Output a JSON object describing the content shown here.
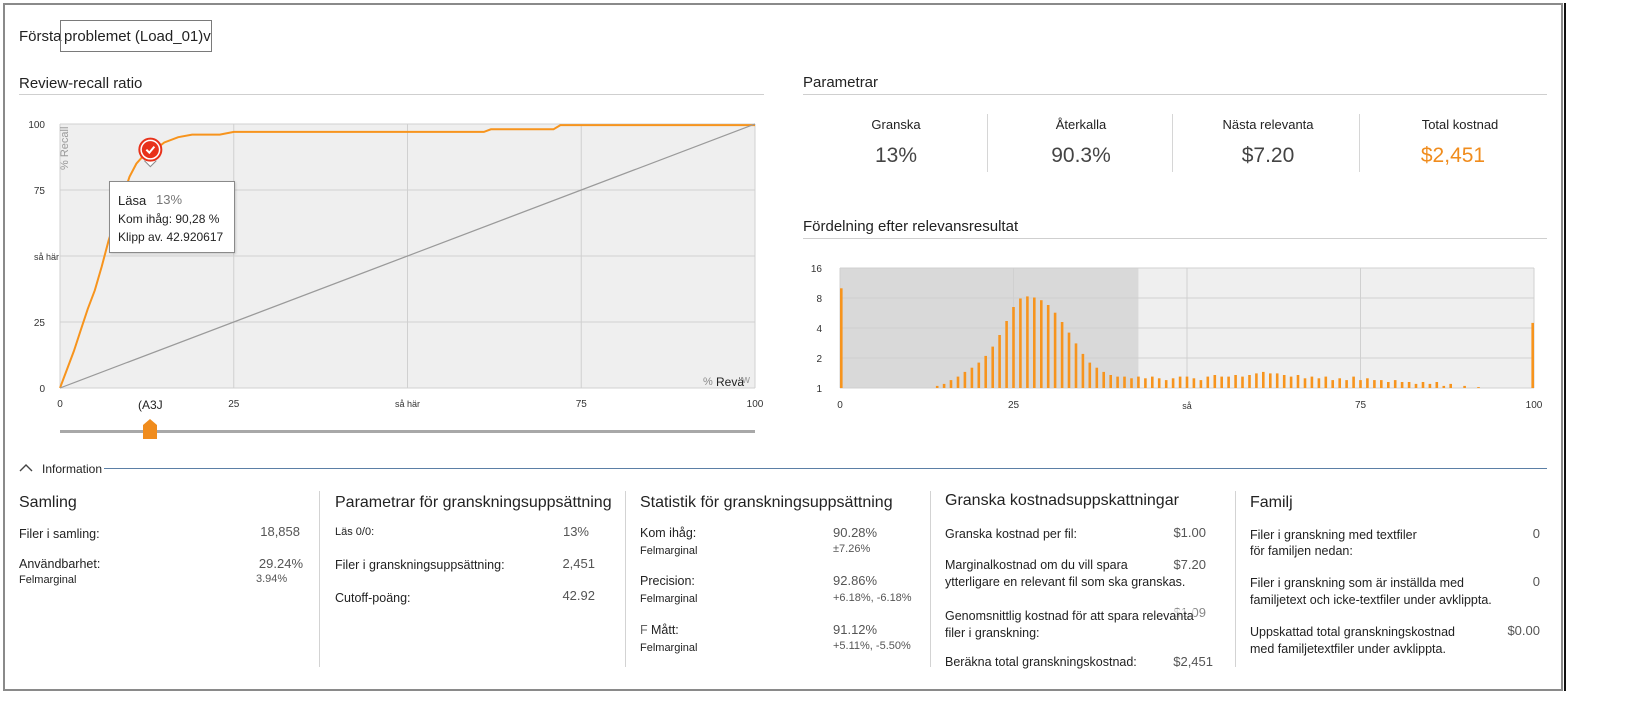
{
  "header": {
    "dropdown_prefix": "Första",
    "dropdown_value": "problemet (Load_01)v"
  },
  "review_chart": {
    "title": "Review-recall ratio",
    "y_axis_label": "% Recall",
    "x_axis_label_prefix": "%",
    "x_axis_label": "Revä",
    "x_axis_label_overlap": "w",
    "y_ticks": [
      "100",
      "75",
      "så här",
      "25",
      "0"
    ],
    "x_ticks": [
      "0",
      "25",
      "så här",
      "75",
      "100"
    ],
    "marker_label": "(A3J",
    "tooltip": {
      "title": "Läsa",
      "review": "13%",
      "recall": "Kom ihåg: 90,28 %",
      "cutoff": "Klipp av. 42.920617"
    },
    "colors": {
      "curve": "#f7941d",
      "diagonal": "#9a9a9a",
      "marker": "#e8321b",
      "plot_bg": "#efefef"
    }
  },
  "chart_data": [
    {
      "type": "line",
      "title": "Review-recall ratio",
      "xlabel": "% Revä",
      "ylabel": "% Recall",
      "xlim": [
        0,
        100
      ],
      "ylim": [
        0,
        100
      ],
      "grid": true,
      "series": [
        {
          "x": [
            0,
            2,
            3,
            4,
            5,
            6,
            7,
            8,
            9,
            10,
            11,
            12,
            13,
            14,
            15,
            17,
            19,
            21,
            23,
            25,
            30,
            40,
            50,
            60,
            61,
            62,
            65,
            70,
            71,
            72,
            80,
            90,
            100
          ],
          "values": [
            0,
            14,
            22,
            30,
            37,
            46,
            56,
            64,
            72,
            80,
            85,
            88,
            90.28,
            91,
            93,
            95,
            96,
            96,
            96,
            97,
            97,
            97,
            97,
            97,
            97,
            98,
            98,
            98,
            98,
            99.6,
            99.6,
            99.6,
            99.6
          ]
        },
        {
          "x": [
            0,
            100
          ],
          "values": [
            0,
            100
          ]
        }
      ]
    },
    {
      "type": "bar",
      "title": "Fördelning efter relevansresultat",
      "xlabel": "så",
      "xlim": [
        0,
        100
      ],
      "y_ticks": [
        "16",
        "8",
        "4",
        "2",
        "1"
      ],
      "x_ticks": [
        "0",
        "25",
        "så",
        "75",
        "100"
      ],
      "highlight_range": [
        0,
        43
      ],
      "x": [
        0,
        14,
        15,
        16,
        17,
        18,
        19,
        20,
        21,
        22,
        23,
        24,
        25,
        26,
        27,
        28,
        29,
        30,
        31,
        32,
        33,
        34,
        35,
        36,
        37,
        38,
        39,
        40,
        41,
        42,
        43,
        44,
        45,
        46,
        47,
        48,
        49,
        50,
        51,
        52,
        53,
        54,
        55,
        56,
        57,
        58,
        59,
        60,
        61,
        62,
        63,
        64,
        65,
        66,
        67,
        68,
        69,
        70,
        71,
        72,
        73,
        74,
        75,
        76,
        77,
        78,
        79,
        80,
        81,
        82,
        83,
        84,
        85,
        86,
        87,
        88,
        90,
        92,
        100
      ],
      "values": [
        10,
        1.05,
        1.1,
        1.2,
        1.3,
        1.45,
        1.6,
        1.8,
        2.1,
        2.6,
        3.4,
        4.7,
        6.5,
        7.9,
        8.3,
        8.1,
        7.6,
        6.8,
        5.7,
        4.6,
        3.6,
        2.8,
        2.2,
        1.8,
        1.6,
        1.45,
        1.35,
        1.3,
        1.3,
        1.25,
        1.3,
        1.25,
        1.3,
        1.25,
        1.2,
        1.25,
        1.3,
        1.3,
        1.25,
        1.2,
        1.3,
        1.35,
        1.3,
        1.3,
        1.35,
        1.3,
        1.35,
        1.4,
        1.45,
        1.4,
        1.4,
        1.35,
        1.3,
        1.35,
        1.25,
        1.3,
        1.25,
        1.3,
        1.2,
        1.25,
        1.2,
        1.3,
        1.2,
        1.25,
        1.2,
        1.2,
        1.15,
        1.2,
        1.15,
        1.15,
        1.1,
        1.15,
        1.1,
        1.15,
        1.05,
        1.1,
        1.05,
        1.02,
        4.5
      ]
    }
  ],
  "slider": {
    "value_percent": 13
  },
  "parameters": {
    "title": "Parametrar",
    "items": [
      {
        "label": "Granska",
        "value": "13%"
      },
      {
        "label": "Återkalla",
        "value": "90.3%"
      },
      {
        "label": "Nästa relevanta",
        "value": "$7.20"
      },
      {
        "label": "Total kostnad",
        "value": "$2,451"
      }
    ],
    "accent": "#f08c1d"
  },
  "distribution": {
    "title": "Fördelning efter relevansresultat",
    "y_ticks": [
      "16",
      "8",
      "4",
      "2",
      "1"
    ],
    "x_ticks": [
      "0",
      "25",
      "så",
      "75",
      "100"
    ],
    "colors": {
      "bar": "#f7941d",
      "highlight": "#d9d9d9",
      "plot_bg": "#efefef"
    }
  },
  "information": {
    "toggle_label": "Information",
    "samling": {
      "title": "Samling",
      "row1_label": "Filer i samling:",
      "row1_value": "18,858",
      "row2_label": "Användbarhet:",
      "row2_value": "29.24%",
      "row2_sub": "Felmarginal",
      "row2_sub_value": "3.94%"
    },
    "params": {
      "title": "Parametrar för granskningsuppsättning",
      "row1_label": "Läs 0/0:",
      "row1_value": "13%",
      "row2_label": "Filer i granskningsuppsättning:",
      "row2_value": "2,451",
      "row3_label": "Cutoff-poäng:",
      "row3_value": "42.92"
    },
    "stats": {
      "title": "Statistik för granskningsuppsättning",
      "row1_label": "Kom ihåg:",
      "row1_sub": "Felmarginal",
      "row1_value": "90.28%",
      "row1_sub_value": "±7.26%",
      "row2_label": "Precision:",
      "row2_sub": "Felmarginal",
      "row2_value": "92.86%",
      "row2_sub_value": "+6.18%, -6.18%",
      "row3_prefix": "F",
      "row3_label": "Mått:",
      "row3_sub": "Felmarginal",
      "row3_value": "91.12%",
      "row3_sub_value": "+5.11%, -5.50%"
    },
    "costs": {
      "title": "Granska kostnadsuppskattningar",
      "row1_label": "Granska kostnad per fil:",
      "row1_value": "$1.00",
      "row2_label_1": "Marginalkostnad om du vill spara",
      "row2_label_2": "ytterligare en relevant fil som ska granskas.",
      "row2_value": "$7.20",
      "row3_label_1": "Genomsnittlig kostnad för att spara relevanta",
      "row3_label_2": "filer i granskning:",
      "row3_value": "$1.09",
      "row4_label": "Beräkna total granskningskostnad:",
      "row4_value": "$2,451"
    },
    "family": {
      "title": "Familj",
      "row1_label_1": "Filer i granskning med textfiler",
      "row1_label_2": "för familjen nedan:",
      "row1_value": "0",
      "row2_label_1": "Filer i granskning som är inställda med",
      "row2_label_2": "familjetext och icke-textfiler under avklippta.",
      "row2_value": "0",
      "row3_label_1": "Uppskattad total granskningskostnad",
      "row3_label_2": "med familjetextfiler under avklippta.",
      "row3_value": "$0.00"
    }
  }
}
